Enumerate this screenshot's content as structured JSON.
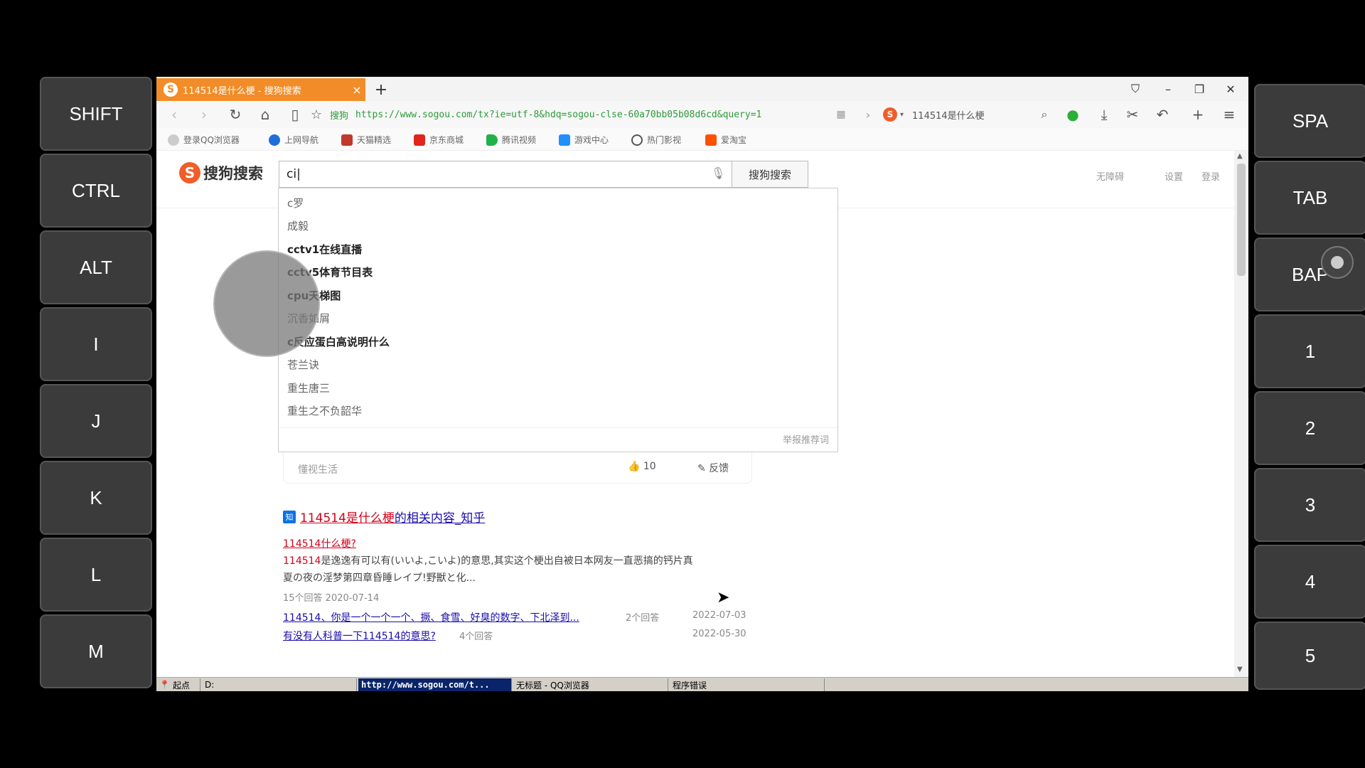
{
  "keys_left": [
    "SHIFT",
    "CTRL",
    "ALT",
    "I",
    "J",
    "K",
    "L",
    "M"
  ],
  "keys_right": [
    "SPA",
    "TAB",
    "BAP",
    "1",
    "2",
    "3",
    "4",
    "5"
  ],
  "tab": {
    "title": "114514是什么梗 - 搜狗搜索",
    "close": "×",
    "logo": "S"
  },
  "new_tab": "+",
  "toolbar": {
    "site_label": "搜狗",
    "url": "https://www.sogou.com/tx?ie=utf-8&hdq=sogou-clse-60a70bb05b08d6cd&query=1",
    "search_text": "114514是什么梗"
  },
  "bookmarks": [
    {
      "label": "登录QQ浏览器",
      "color": "#cccccc"
    },
    {
      "label": "上网导航",
      "color": "#1e6fd9"
    },
    {
      "label": "天猫精选",
      "color": "#c0392b"
    },
    {
      "label": "京东商城",
      "color": "#e1251b"
    },
    {
      "label": "腾讯视频",
      "color": "#20b14a"
    },
    {
      "label": "游戏中心",
      "color": "#1e90ff"
    },
    {
      "label": "热门影视",
      "color": "#555555"
    },
    {
      "label": "爱淘宝",
      "color": "#ff5000"
    }
  ],
  "logo": {
    "mark": "S",
    "text": "搜狗搜索"
  },
  "search": {
    "value": "ci|",
    "button": "搜狗搜索"
  },
  "top_links": [
    "无障碍",
    "设置",
    "登录"
  ],
  "suggestions": [
    {
      "text": "c罗",
      "bold": false
    },
    {
      "text": "成毅",
      "bold": false
    },
    {
      "text": "cctv1在线直播",
      "bold": true
    },
    {
      "text": "cctv5体育节目表",
      "bold": true
    },
    {
      "text": "cpu天梯图",
      "bold": true
    },
    {
      "text": "沉香如屑",
      "bold": false
    },
    {
      "text": "c反应蛋白高说明什么",
      "bold": true
    },
    {
      "text": "苍兰诀",
      "bold": false
    },
    {
      "text": "重生唐三",
      "bold": false
    },
    {
      "text": "重生之不负韶华",
      "bold": false
    }
  ],
  "suggest_report": "举报推荐词",
  "card": {
    "source": "懂视生活",
    "likes": "10",
    "feedback": "反馈"
  },
  "result": {
    "zh_mark": "知",
    "title_red": "114514是什么梗",
    "title_rest": "的相关内容_知乎",
    "sub_q": "114514什么梗?",
    "snippet_red": "114514",
    "snippet_1": "是逸逸有可以有(いいよ,こいよ)的意思,其实这个梗出自被日本网友一直恶搞的钙片真",
    "snippet_2": "夏の夜の淫梦第四章昏睡レイプ!野獣と化...",
    "meta": "15个回答  2020-07-14",
    "links": [
      {
        "text": "114514、你是一个一个一个、撅、食雪、好臭的数字、下北泽到...",
        "count": "2个回答",
        "date": "2022-07-03"
      },
      {
        "text": "有没有人科普一下114514的意思?",
        "count": "4个回答",
        "date": "2022-05-30"
      }
    ]
  },
  "statusbar": {
    "start": "起点",
    "drive": "D:",
    "active": "http://www.sogou.com/t...",
    "window2": "无标题 - QQ浏览器",
    "window3": "程序错误"
  }
}
